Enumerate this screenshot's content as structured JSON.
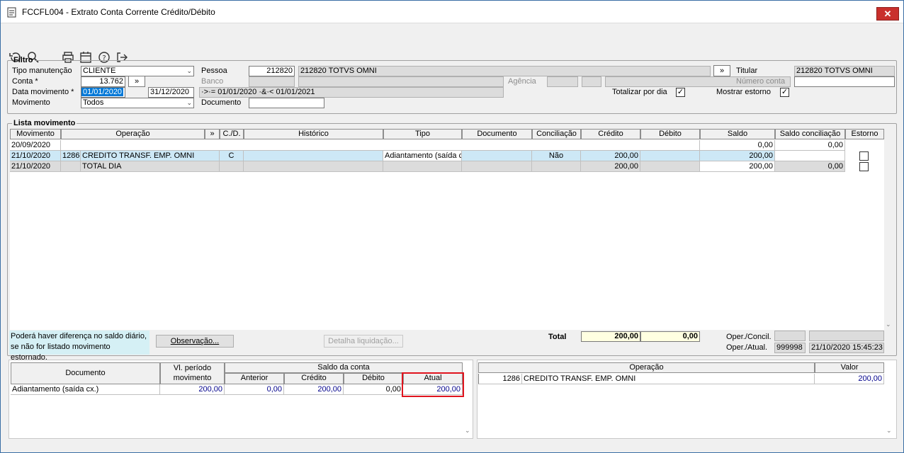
{
  "window": {
    "title": "FCCFL004 - Extrato Conta Corrente Crédito/Débito",
    "close_label": "✕"
  },
  "toolbar": {
    "icons": [
      "undo-icon",
      "search-icon",
      "print-icon",
      "calendar-icon",
      "help-icon",
      "exit-icon"
    ]
  },
  "filtro": {
    "legend": "Filtro",
    "tipo_manutencao_label": "Tipo manutenção",
    "tipo_manutencao_value": "CLIENTE",
    "conta_label": "Conta *",
    "conta_value": "13.762",
    "more_label": "»",
    "data_movimento_label": "Data movimento *",
    "data_inicio": "01/01/2020",
    "data_fim": "31/12/2020",
    "data_expr": "·>·= 01/01/2020 ·&·< 01/01/2021",
    "movimento_label": "Movimento",
    "movimento_value": "Todos",
    "pessoa_label": "Pessoa",
    "pessoa_code": "212820",
    "pessoa_name": "212820  TOTVS OMNI",
    "banco_label": "Banco",
    "agencia_label": "Agência",
    "documento_label": "Documento",
    "titular_label": "Titular",
    "titular_value": "212820  TOTVS OMNI",
    "numero_conta_label": "Número conta",
    "totalizar_label": "Totalizar por dia",
    "mostrar_estorno_label": "Mostrar estorno",
    "check": "✓"
  },
  "lista": {
    "legend": "Lista movimento",
    "headers": [
      "Movimento",
      "Operação",
      "»",
      "C./D.",
      "Histórico",
      "Tipo",
      "Documento",
      "Conciliação",
      "Crédito",
      "Débito",
      "Saldo",
      "Saldo conciliação",
      "Estorno"
    ],
    "rows": [
      {
        "mov": "20/09/2020",
        "cod": "",
        "op": "",
        "cd": "",
        "hist": "",
        "tipo": "",
        "doc": "",
        "conc": "",
        "cred": "",
        "deb": "",
        "saldo": "0,00",
        "saldo_conc": "0,00"
      },
      {
        "mov": "21/10/2020",
        "cod": "1286",
        "op": "CREDITO TRANSF. EMP. OMNI",
        "cd": "C",
        "hist": "",
        "tipo": "Adiantamento (saída c",
        "doc": "",
        "conc": "Não",
        "cred": "200,00",
        "deb": "",
        "saldo": "200,00",
        "saldo_conc": ""
      },
      {
        "mov": "21/10/2020",
        "cod": "",
        "op": "TOTAL DIA",
        "cd": "",
        "hist": "",
        "tipo": "",
        "doc": "",
        "conc": "",
        "cred": "200,00",
        "deb": "",
        "saldo": "200,00",
        "saldo_conc": "0,00"
      }
    ]
  },
  "footer": {
    "note_line1": "Poderá haver diferença no saldo diário,",
    "note_line2": "se não for listado movimento estornado.",
    "observacao_label": "Observação...",
    "detalha_label": "Detalha liquidação...",
    "total_label": "Total",
    "total_credito": "200,00",
    "total_debito": "0,00",
    "oper_concil_label": "Oper./Concil.",
    "oper_atual_label": "Oper./Atual.",
    "oper_atual_code": "999998",
    "oper_atual_ts": "21/10/2020 15:45:23"
  },
  "resumo": {
    "h_documento": "Documento",
    "h_vl_periodo_1": "Vl. período",
    "h_vl_periodo_2": "movimento",
    "h_saldo_conta": "Saldo da conta",
    "h_anterior": "Anterior",
    "h_credito": "Crédito",
    "h_debito": "Débito",
    "h_atual": "Atual",
    "row": {
      "doc": "Adiantamento (saída cx.)",
      "vl": "200,00",
      "ant": "0,00",
      "cred": "200,00",
      "deb": "0,00",
      "atual": "200,00"
    },
    "highlight_color": "#e0141e"
  },
  "operacoes": {
    "h_operacao": "Operação",
    "h_valor": "Valor",
    "row": {
      "code": "1286",
      "name": "CREDITO TRANSF. EMP. OMNI",
      "valor": "200,00"
    }
  }
}
